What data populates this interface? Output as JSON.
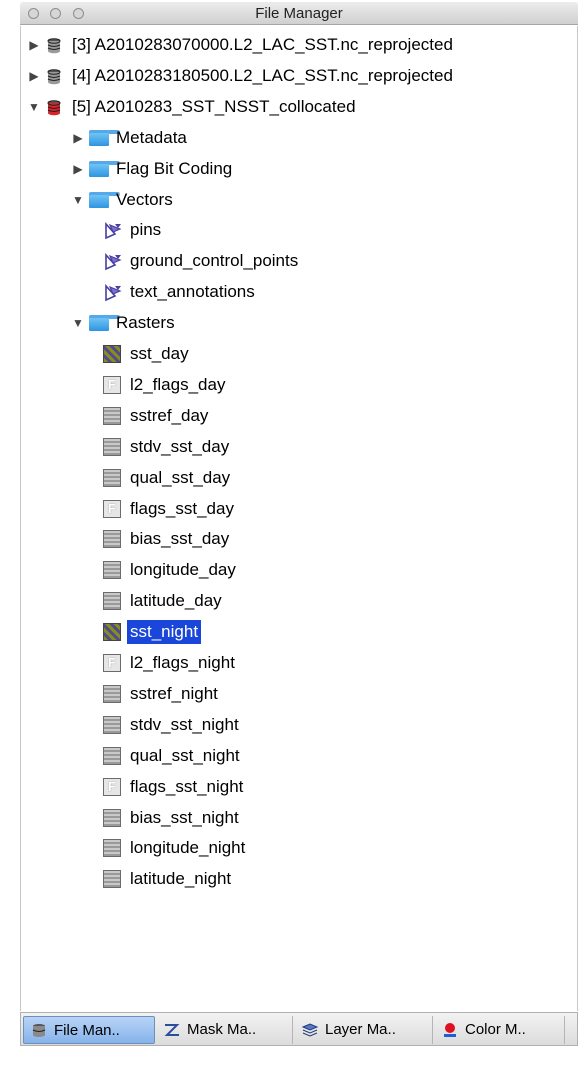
{
  "window": {
    "title": "File Manager"
  },
  "tree": [
    {
      "level": 0,
      "expander": "collapsed",
      "icon": "product-db-icon",
      "label": "[3] A2010283070000.L2_LAC_SST.nc_reprojected"
    },
    {
      "level": 0,
      "expander": "collapsed",
      "icon": "product-db-icon",
      "label": "[4] A2010283180500.L2_LAC_SST.nc_reprojected"
    },
    {
      "level": 0,
      "expander": "expanded",
      "icon": "product-db-red-icon",
      "label": "[5] A2010283_SST_NSST_collocated"
    },
    {
      "level": 1,
      "expander": "collapsed",
      "icon": "folder-icon",
      "label": "Metadata"
    },
    {
      "level": 1,
      "expander": "collapsed",
      "icon": "folder-icon",
      "label": "Flag Bit Coding"
    },
    {
      "level": 1,
      "expander": "expanded",
      "icon": "folder-icon",
      "label": "Vectors"
    },
    {
      "level": 2,
      "expander": "none",
      "icon": "vector-icon",
      "label": "pins"
    },
    {
      "level": 2,
      "expander": "none",
      "icon": "vector-icon",
      "label": "ground_control_points"
    },
    {
      "level": 2,
      "expander": "none",
      "icon": "vector-icon",
      "label": "text_annotations"
    },
    {
      "level": 1,
      "expander": "expanded",
      "icon": "folder-icon",
      "label": "Rasters"
    },
    {
      "level": 2,
      "expander": "none",
      "icon": "raster-color-icon",
      "label": "sst_day"
    },
    {
      "level": 2,
      "expander": "none",
      "icon": "raster-flag-icon",
      "label": "l2_flags_day"
    },
    {
      "level": 2,
      "expander": "none",
      "icon": "raster-icon",
      "label": "sstref_day"
    },
    {
      "level": 2,
      "expander": "none",
      "icon": "raster-icon",
      "label": "stdv_sst_day"
    },
    {
      "level": 2,
      "expander": "none",
      "icon": "raster-icon",
      "label": "qual_sst_day"
    },
    {
      "level": 2,
      "expander": "none",
      "icon": "raster-flag-icon",
      "label": "flags_sst_day"
    },
    {
      "level": 2,
      "expander": "none",
      "icon": "raster-icon",
      "label": "bias_sst_day"
    },
    {
      "level": 2,
      "expander": "none",
      "icon": "raster-icon",
      "label": "longitude_day"
    },
    {
      "level": 2,
      "expander": "none",
      "icon": "raster-icon",
      "label": "latitude_day"
    },
    {
      "level": 2,
      "expander": "none",
      "icon": "raster-color-icon",
      "label": "sst_night",
      "selected": true
    },
    {
      "level": 2,
      "expander": "none",
      "icon": "raster-flag-icon",
      "label": "l2_flags_night"
    },
    {
      "level": 2,
      "expander": "none",
      "icon": "raster-icon",
      "label": "sstref_night"
    },
    {
      "level": 2,
      "expander": "none",
      "icon": "raster-icon",
      "label": "stdv_sst_night"
    },
    {
      "level": 2,
      "expander": "none",
      "icon": "raster-icon",
      "label": "qual_sst_night"
    },
    {
      "level": 2,
      "expander": "none",
      "icon": "raster-flag-icon",
      "label": "flags_sst_night"
    },
    {
      "level": 2,
      "expander": "none",
      "icon": "raster-icon",
      "label": "bias_sst_night"
    },
    {
      "level": 2,
      "expander": "none",
      "icon": "raster-icon",
      "label": "longitude_night"
    },
    {
      "level": 2,
      "expander": "none",
      "icon": "raster-icon",
      "label": "latitude_night"
    }
  ],
  "tabs": [
    {
      "label": "File Man..",
      "icon": "database-icon",
      "active": true
    },
    {
      "label": "Mask Ma..",
      "icon": "mask-icon",
      "active": false
    },
    {
      "label": "Layer Ma..",
      "icon": "layers-icon",
      "active": false
    },
    {
      "label": "Color M..",
      "icon": "color-icon",
      "active": false
    }
  ],
  "colors": {
    "selection": "#1a47d9",
    "folder": "#3fa6ec",
    "vector": "#4a3f9e",
    "product_red": "#d9262b"
  }
}
